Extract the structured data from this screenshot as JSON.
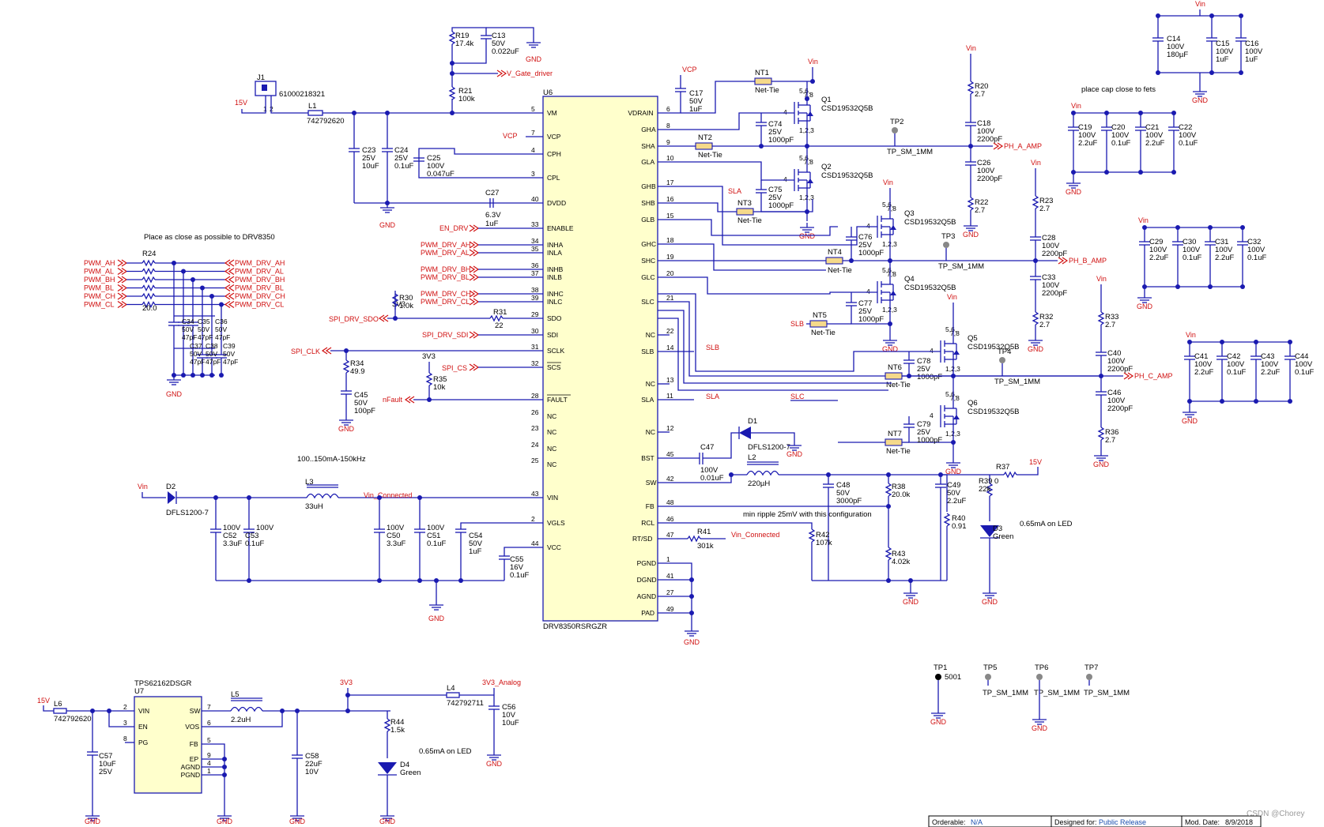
{
  "ic_main": {
    "ref": "U6",
    "part": "DRV8350RSRGZR",
    "left_pins": [
      [
        "VM",
        "5"
      ],
      [
        "VCP",
        "7"
      ],
      [
        "CPH",
        "4"
      ],
      [
        "CPL",
        "3"
      ],
      [
        "DVDD",
        "40"
      ],
      [
        "ENABLE",
        "33"
      ],
      [
        "INHA",
        "34"
      ],
      [
        "INLA",
        "35"
      ],
      [
        "INHB",
        "36"
      ],
      [
        "INLB",
        "37"
      ],
      [
        "INHC",
        "38"
      ],
      [
        "INLC",
        "39"
      ],
      [
        "SDO",
        "29"
      ],
      [
        "SDI",
        "30"
      ],
      [
        "SCLK",
        "31"
      ],
      [
        "SCS",
        "32"
      ],
      [
        "FAULT",
        "28"
      ],
      [
        "NC",
        "26"
      ],
      [
        "NC",
        "23"
      ],
      [
        "NC",
        "24"
      ],
      [
        "NC",
        "25"
      ],
      [
        "VIN",
        "43"
      ],
      [
        "VGLS",
        "2"
      ],
      [
        "VCC",
        "44"
      ]
    ],
    "right_pins": [
      [
        "VDRAIN",
        "6"
      ],
      [
        "GHA",
        "8"
      ],
      [
        "SHA",
        "9"
      ],
      [
        "GLA",
        "10"
      ],
      [
        "GHB",
        "17"
      ],
      [
        "SHB",
        "16"
      ],
      [
        "GLB",
        "15"
      ],
      [
        "GHC",
        "18"
      ],
      [
        "SHC",
        "19"
      ],
      [
        "GLC",
        "20"
      ],
      [
        "SLC",
        "21"
      ],
      [
        "NC",
        "22"
      ],
      [
        "SLB",
        "14"
      ],
      [
        "NC",
        "13"
      ],
      [
        "SLA",
        "11"
      ],
      [
        "NC",
        "12"
      ],
      [
        "BST",
        "45"
      ],
      [
        "SW",
        "42"
      ],
      [
        "FB",
        "48"
      ],
      [
        "RCL",
        "46"
      ],
      [
        "RT/SD",
        "47"
      ],
      [
        "PGND",
        "1"
      ],
      [
        "DGND",
        "41"
      ],
      [
        "AGND",
        "27"
      ],
      [
        "PAD",
        "49"
      ]
    ]
  },
  "ic_reg": {
    "title": "TPS62162DSGR",
    "ref": "U7",
    "left_pins": [
      [
        "VIN",
        "2"
      ],
      [
        "EN",
        "3"
      ],
      [
        "PG",
        "8"
      ]
    ],
    "right_pins": [
      [
        "SW",
        "7"
      ],
      [
        "VOS",
        "6"
      ],
      [
        "FB",
        "5"
      ],
      [
        "EP",
        "9"
      ],
      [
        "AGND",
        "4"
      ],
      [
        "PGND",
        "1"
      ]
    ]
  },
  "net_labels": {
    "v15": "15V",
    "vin": "Vin",
    "vcp": "VCP",
    "v_gate": "V_Gate_driver",
    "gnd": "GND",
    "v3v3": "3V3",
    "v3v3_analog": "3V3_Analog",
    "vin_connected": "Vin_Connected",
    "en_drv": "EN_DRV",
    "pwm_drv_ah": "PWM_DRV_AH",
    "pwm_drv_al": "PWM_DRV_AL",
    "pwm_drv_bh": "PWM_DRV_BH",
    "pwm_drv_bl": "PWM_DRV_BL",
    "pwm_drv_ch": "PWM_DRV_CH",
    "pwm_drv_cl": "PWM_DRV_CL",
    "pwm_ah": "PWM_AH",
    "pwm_al": "PWM_AL",
    "pwm_bh": "PWM_BH",
    "pwm_bl": "PWM_BL",
    "pwm_ch": "PWM_CH",
    "pwm_cl": "PWM_CL",
    "spi_drv_sdo": "SPI_DRV_SDO",
    "spi_drv_sdi": "SPI_DRV_SDI",
    "spi_clk": "SPI_CLK",
    "spi_cs": "SPI_CS",
    "nfault": "nFault",
    "sla": "SLA",
    "slb": "SLB",
    "slc": "SLC",
    "ph_a": "PH_A_AMP",
    "ph_b": "PH_B_AMP",
    "ph_c": "PH_C_AMP"
  },
  "notes": {
    "place_drv": "Place as close as possible to DRV8350",
    "freq": "100..150mA-150kHz",
    "ripple": "min ripple 25mV with this configuration",
    "led1": "0.65mA on LED",
    "led2": "0.65mA on LED",
    "cap_fets": "place cap close to fets"
  },
  "parts": {
    "J1": "J1",
    "J1v": "61000218321",
    "L1": "L1",
    "L1v": "742792620",
    "R19": "R19",
    "R19v": "17.4k",
    "C13": "C13",
    "C13a": "50V",
    "C13b": "0.022uF",
    "R21": "R21",
    "R21v": "100k",
    "C23": "C23",
    "C23a": "25V",
    "C23b": "10uF",
    "C24": "C24",
    "C24a": "25V",
    "C24b": "0.1uF",
    "C25": "C25",
    "C25a": "100V",
    "C25b": "0.047uF",
    "C27": "C27",
    "C27a": "6.3V",
    "C27b": "1uF",
    "R24": "R24",
    "R24v": "20.0",
    "R30": "R30",
    "R30v": "1.0k",
    "R31": "R31",
    "R31v": "22",
    "R34": "R34",
    "R34v": "49.9",
    "R35": "R35",
    "R35v": "10k",
    "C45": "C45",
    "C45a": "50V",
    "C45b": "100pF",
    "C34": "C34",
    "C35": "C35",
    "C36": "C36",
    "C37": "C37",
    "C38": "C38",
    "C39": "C39",
    "C50V": "50V",
    "C47pF": "47pF",
    "C17": "C17",
    "C17a": "50V",
    "C17b": "1uF",
    "NT1": "NT1",
    "NT2": "NT2",
    "NT3": "NT3",
    "NT4": "NT4",
    "NT5": "NT5",
    "NT6": "NT6",
    "NT7": "NT7",
    "NetTie": "Net-Tie",
    "Q1": "Q1",
    "Q2": "Q2",
    "Q3": "Q3",
    "Q4": "Q4",
    "Q5": "Q5",
    "Q6": "Q6",
    "Qv": "CSD19532Q5B",
    "C74": "C74",
    "C75": "C75",
    "C76": "C76",
    "C77": "C77",
    "C78": "C78",
    "C79": "C79",
    "C25V": "25V",
    "C1000pF": "1000pF",
    "TP1": "TP1",
    "TP1v": "5001",
    "TP2": "TP2",
    "TP3": "TP3",
    "TP4": "TP4",
    "TP5": "TP5",
    "TP6": "TP6",
    "TP7": "TP7",
    "TPv": "TP_SM_1MM",
    "R20": "R20",
    "R22": "R22",
    "R23": "R23",
    "R32": "R32",
    "R33": "R33",
    "R36": "R36",
    "R2v": "2.7",
    "C18": "C18",
    "C26": "C26",
    "C28": "C28",
    "C33": "C33",
    "C40": "C40",
    "C46": "C46",
    "C100V": "100V",
    "C2200pF": "2200pF",
    "C14": "C14",
    "C14a": "100V",
    "C14b": "180µF",
    "C15": "C15",
    "C16": "C16",
    "C1uF": "1uF",
    "C19": "C19",
    "C20": "C20",
    "C21": "C21",
    "C22": "C22",
    "C29": "C29",
    "C30": "C30",
    "C31": "C31",
    "C32": "C32",
    "C41": "C41",
    "C42": "C42",
    "C43": "C43",
    "C44": "C44",
    "C22uF": "2.2uF",
    "C01uF": "0.1uF",
    "D1": "D1",
    "D1v": "DFLS1200-7",
    "D2": "D2",
    "D2v": "DFLS1200-7",
    "C47": "C47",
    "C47a": "100V",
    "C47b": "0.01uF",
    "L2": "L2",
    "L2v": "220µH",
    "L3": "L3",
    "L3v": "33uH",
    "C48": "C48",
    "C48a": "50V",
    "C48b": "3000pF",
    "R38": "R38",
    "R38v": "20.0k",
    "R43": "R43",
    "R43v": "4.02k",
    "C49": "C49",
    "C49a": "50V",
    "C49b": "2.2uF",
    "R40": "R40",
    "R40v": "0.91",
    "R39": "R39",
    "R39v": "22k",
    "R37": "R37",
    "R37v": "0",
    "D3": "D3",
    "D3v": "Green",
    "D4": "D4",
    "D4v": "Green",
    "R41": "R41",
    "R41v": "301k",
    "R42": "R42",
    "R42v": "107k",
    "C52": "C52",
    "C52a": "100V",
    "C52b": "3.3uF",
    "C53": "C53",
    "C53a": "100V",
    "C53b": "0.1uF",
    "C50": "C50",
    "C50a": "100V",
    "C50b": "3.3uF",
    "C51": "C51",
    "C51a": "100V",
    "C51b": "0.1uF",
    "C54": "C54",
    "C54a": "50V",
    "C54b": "1uF",
    "C55": "C55",
    "C55a": "16V",
    "C55b": "0.1uF",
    "L6": "L6",
    "L6v": "742792620",
    "C57": "C57",
    "C57a": "10uF",
    "C57b": "25V",
    "L5": "L5",
    "L5v": "2.2uH",
    "C58": "C58",
    "C58a": "22uF",
    "C58b": "10V",
    "R44": "R44",
    "R44v": "1.5k",
    "L4": "L4",
    "L4v": "742792711",
    "C56": "C56",
    "C56a": "10V",
    "C56b": "10uF"
  },
  "title_block": {
    "orderable_label": "Orderable:",
    "orderable_value": "N/A",
    "designed_label": "Designed for:",
    "designed_value": "Public Release",
    "mod_label": "Mod. Date:",
    "mod_value": "8/9/2018"
  },
  "watermark": "CSDN @Chorey",
  "colors": {
    "wire": "#1a1ab0",
    "net": "#d01010",
    "ic_fill": "#ffffcc",
    "nettie": "#f5d98a"
  }
}
